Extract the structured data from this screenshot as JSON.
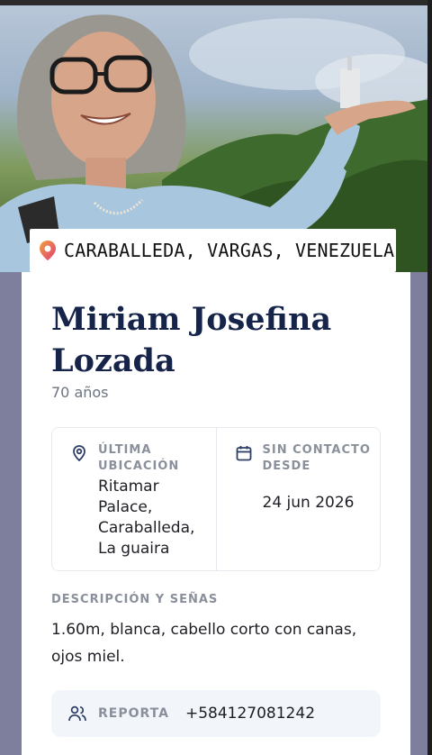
{
  "location_chip": {
    "text": "CARABALLEDA, VARGAS, VENEZUELA"
  },
  "person": {
    "name": "Miriam Josefina Lozada",
    "age": "70 años"
  },
  "last_location": {
    "label": "ÚLTIMA UBICACIÓN",
    "value": "Ritamar Palace, Caraballeda, La guaira"
  },
  "no_contact": {
    "label": "SIN CONTACTO DESDE",
    "value": "24 jun 2026"
  },
  "description": {
    "label": "DESCRIPCIÓN Y SEÑAS",
    "text": "1.60m, blanca, cabello corto con canas, ojos miel."
  },
  "report": {
    "label": "REPORTA",
    "phone": "+584127081242"
  },
  "colors": {
    "accent_pin": "#e8456b",
    "name": "#16244a",
    "muted": "#8a909b",
    "icon": "#2d3e66"
  }
}
